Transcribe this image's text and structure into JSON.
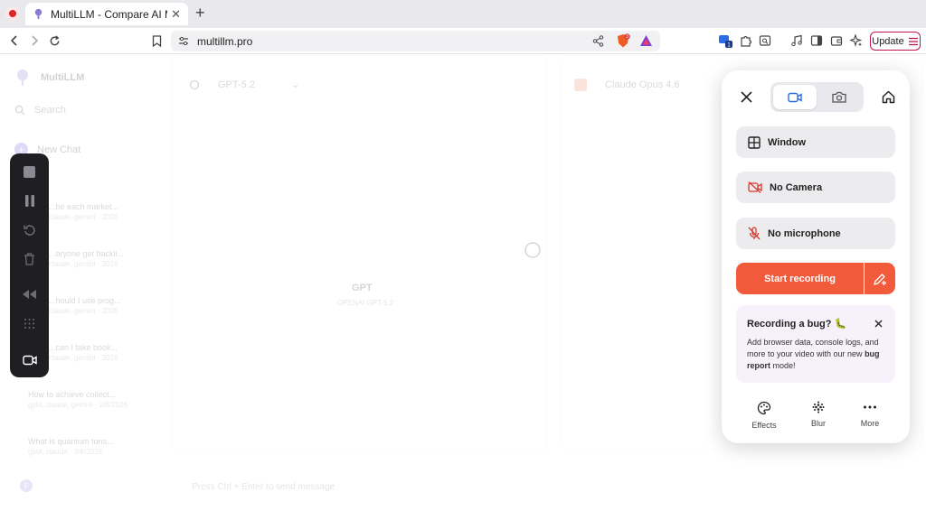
{
  "browser": {
    "tab_title": "MultiLLM - Compare AI Models",
    "url": "multillm.pro",
    "update_label": "Update",
    "shield_badge": "3"
  },
  "page": {
    "brand": "MultiLLM",
    "search_label": "Search",
    "new_chat_label": "New Chat",
    "history": [
      {
        "title": "...be each market...",
        "meta": "claude, gemini · 2026"
      },
      {
        "title": "...eryone get backli...",
        "meta": "claude, gemini · 2026"
      },
      {
        "title": "...hould I use prog...",
        "meta": "claude, gemini · 2026"
      },
      {
        "title": "...can I take book...",
        "meta": "claude, gemini · 2026"
      },
      {
        "title": "How to achieve collect...",
        "meta": "gpt4, claude, gemini · 2/6/2026"
      },
      {
        "title": "What is quantum tuns...",
        "meta": "gpt4, claude · 2/6/2026"
      }
    ],
    "avatar_initial": "F",
    "panel1_model": "GPT-5.2",
    "panel1_center_label": "GPT",
    "panel1_center_sub": "OPENAI GPT-5.2",
    "panel2_model": "Claude Opus 4.6",
    "chat_placeholder": "Press Ctrl + Enter to send message"
  },
  "recorder": {
    "options": {
      "window": "Window",
      "camera": "No Camera",
      "microphone": "No microphone"
    },
    "start_label": "Start recording",
    "bug_title": "Recording a bug? 🐛",
    "bug_text_1": "Add browser data, console logs, and more to your video with our new ",
    "bug_text_bold": "bug report",
    "bug_text_2": " mode!",
    "footer": {
      "effects": "Effects",
      "blur": "Blur",
      "more": "More"
    },
    "colors": {
      "accent": "#f25a3c",
      "active_tab_icon": "#2b6de8",
      "danger_icon": "#d8372b"
    }
  }
}
